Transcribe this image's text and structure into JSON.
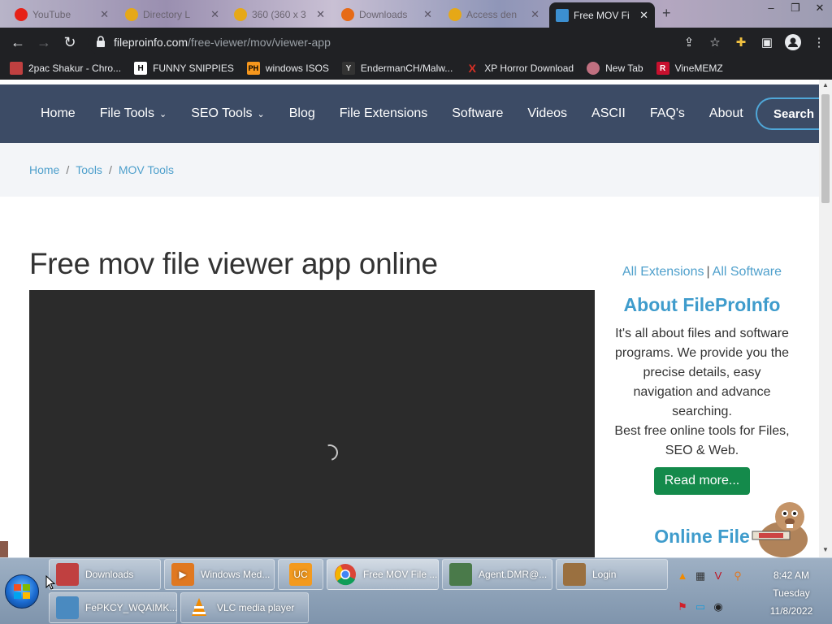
{
  "browser": {
    "tabs": [
      {
        "title": "YouTube",
        "color": "#e62117"
      },
      {
        "title": "Directory L",
        "color": "#e6a817"
      },
      {
        "title": "360 (360 x 3",
        "color": "#e6a817"
      },
      {
        "title": "Downloads",
        "color": "#e66a17"
      },
      {
        "title": "Access den",
        "color": "#e6a817"
      },
      {
        "title": "Free MOV Fi",
        "color": "#3c8fd0",
        "active": true
      }
    ],
    "new_tab": "+",
    "window_controls": [
      "–",
      "❐",
      "✕"
    ],
    "url_host": "fileproinfo.com",
    "url_path": "/free-viewer/mov/viewer-app",
    "bookmarks": [
      {
        "label": "2pac Shakur - Chro...",
        "icon": "film-icon",
        "color": "#e8eaed"
      },
      {
        "label": "FUNNY SNIPPIES",
        "icon": "H",
        "color": "#ffffff"
      },
      {
        "label": "windows ISOS",
        "icon": "PH",
        "color": "#f7971d"
      },
      {
        "label": "EndermanCH/Malw...",
        "icon": "Y",
        "color": "#cccccc"
      },
      {
        "label": "XP Horror Download",
        "icon": "X",
        "color": "#d93025"
      },
      {
        "label": "New Tab",
        "icon": "globe-icon",
        "color": "#c07080"
      },
      {
        "label": "VineMEMZ",
        "icon": "R",
        "color": "#c8102e"
      }
    ]
  },
  "site": {
    "nav": [
      {
        "label": "Home"
      },
      {
        "label": "File Tools",
        "dropdown": true
      },
      {
        "label": "SEO Tools",
        "dropdown": true
      },
      {
        "label": "Blog"
      },
      {
        "label": "File Extensions"
      },
      {
        "label": "Software"
      },
      {
        "label": "Videos"
      },
      {
        "label": "ASCII"
      },
      {
        "label": "FAQ's"
      },
      {
        "label": "About"
      }
    ],
    "search_label": "Search",
    "breadcrumb": [
      "Home",
      "Tools",
      "MOV Tools"
    ],
    "breadcrumb_sep": "/",
    "page_title": "Free mov file viewer app online",
    "side_link_1": "All Extensions",
    "side_link_sep": "|",
    "side_link_2": "All Software",
    "about_heading": "About FileProInfo",
    "about_text_1": "It's all about files and software programs. We provide you the precise details, easy navigation and advance searching.",
    "about_text_2": "Best free online tools for Files, SEO & Web.",
    "read_more": "Read more...",
    "next_heading": "Online File"
  },
  "taskbar": {
    "buttons_row1": [
      {
        "label": "Downloads",
        "icon_color": "#c04040"
      },
      {
        "label": "Windows Med...",
        "icon_color": "#e07820"
      },
      {
        "label": "",
        "icon_color": "#f39a1e"
      },
      {
        "label": "Free MOV File ...",
        "icon_color": "#2a7de1",
        "active": true
      },
      {
        "label": "Agent.DMR@...",
        "icon_color": "#4a7a4a"
      },
      {
        "label": "Login",
        "icon_color": "#9a7040"
      }
    ],
    "buttons_row2": [
      {
        "label": "FePKCY_WQAIMK...",
        "icon_color": "#4a8ac0"
      },
      {
        "label": "VLC media player",
        "icon_color": "#f08a00"
      }
    ],
    "clock_time": "8:42 AM",
    "clock_day": "Tuesday",
    "clock_date": "11/8/2022"
  }
}
